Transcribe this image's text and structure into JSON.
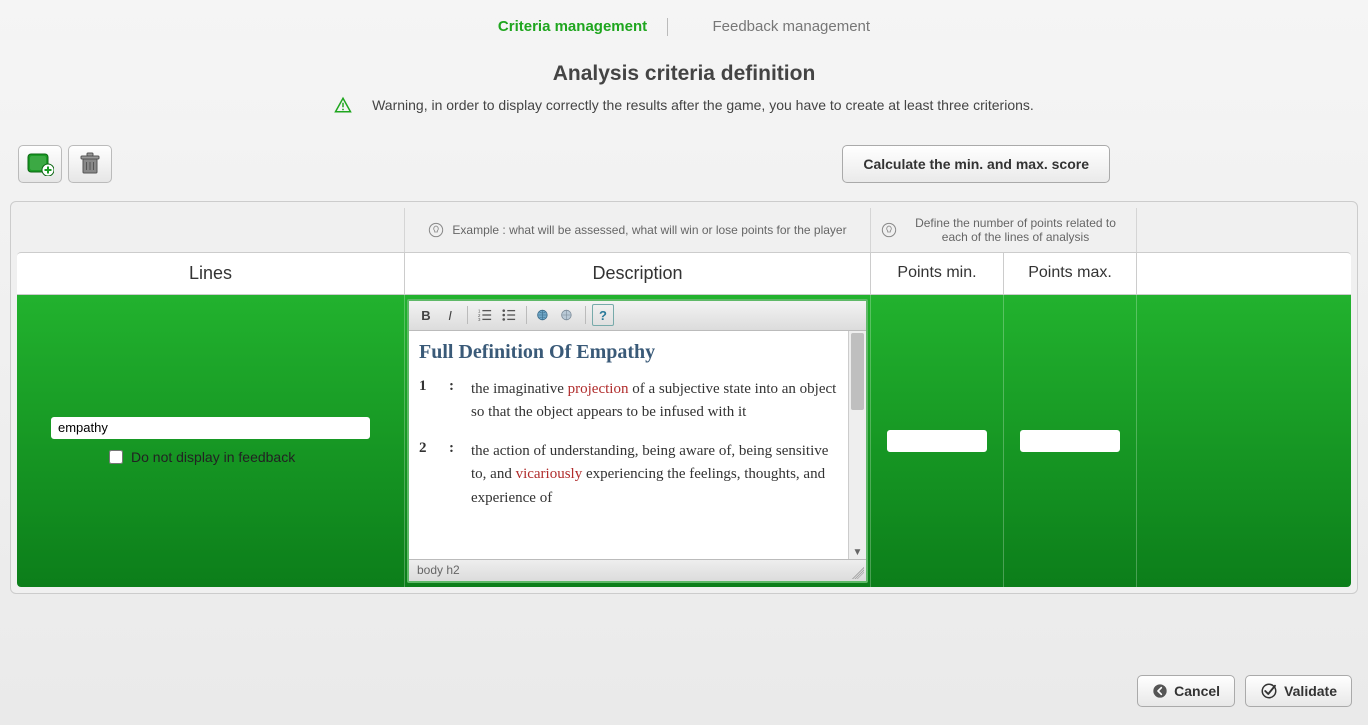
{
  "nav": {
    "criteria": "Criteria management",
    "feedback": "Feedback management"
  },
  "title": "Analysis criteria definition",
  "warning": "Warning, in order to display correctly the results after the game, you have to create at least three criterions.",
  "toolbar": {
    "calculate": "Calculate the min. and max. score"
  },
  "hints": {
    "desc": "Example : what will be assessed, what will win or lose points for the player",
    "points": "Define the number of points related to each of the lines of analysis"
  },
  "headers": {
    "lines": "Lines",
    "desc": "Description",
    "pmin": "Points min.",
    "pmax": "Points max."
  },
  "row": {
    "line_name": "empathy",
    "no_display_label": "Do not display in feedback",
    "pmin": "",
    "pmax": ""
  },
  "editor": {
    "heading": "Full Definition Of Empathy",
    "def1_num": "1",
    "def1_pre": "the imaginative ",
    "def1_link": "projection",
    "def1_post": " of a subjective state into an object so that the object appears to be infused with it",
    "def2_num": "2",
    "def2_pre": "the action of understanding, being aware of, being sensitive to, and ",
    "def2_link": "vicariously",
    "def2_post": " experiencing the feelings, thoughts, and experience of",
    "status": "body  h2"
  },
  "footer": {
    "cancel": "Cancel",
    "validate": "Validate"
  }
}
